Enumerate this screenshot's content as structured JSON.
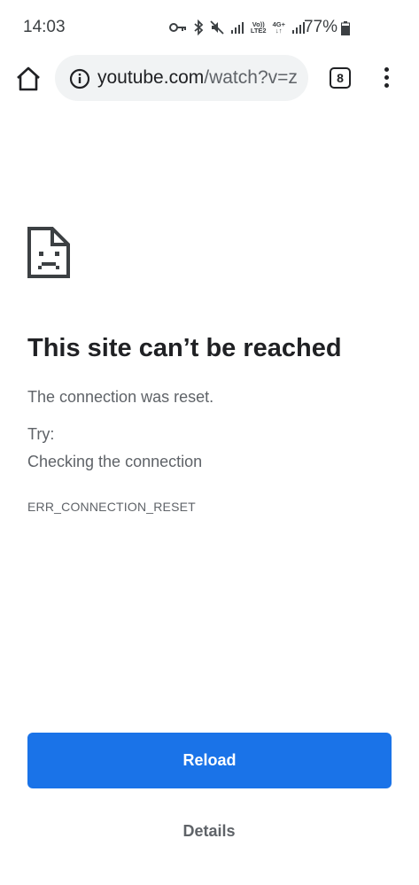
{
  "status_bar": {
    "time": "14:03",
    "network_label_top": "Vo))",
    "network_label_bottom": "LTE2",
    "data_label": "4G+",
    "battery_percent": "77%",
    "icons": [
      "vpn-key-icon",
      "bluetooth-icon",
      "mute-icon",
      "signal-icon",
      "signal-icon",
      "battery-icon"
    ]
  },
  "toolbar": {
    "url_host": "youtube.com",
    "url_path": "/watch?v=z",
    "tab_count": "8",
    "icons": [
      "home-icon",
      "info-icon",
      "tab-switcher-icon",
      "more-vert-icon"
    ]
  },
  "error_page": {
    "icon": "sad-document-icon",
    "heading": "This site can’t be reached",
    "message": "The connection was reset.",
    "try_label": "Try:",
    "suggestion": "Checking the connection",
    "error_code": "ERR_CONNECTION_RESET"
  },
  "actions": {
    "reload_label": "Reload",
    "details_label": "Details",
    "accent_color": "#1a73e8"
  }
}
